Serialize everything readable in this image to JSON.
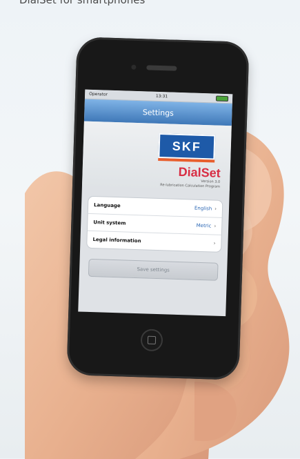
{
  "caption": "DialSet for smartphones",
  "status_bar": {
    "carrier": "Operator",
    "time": "13:31"
  },
  "navbar": {
    "title": "Settings"
  },
  "branding": {
    "logo_text": "SKF",
    "app_name": "DialSet",
    "version": "Version 3.0",
    "tagline": "Re-lubrication Calculation Program"
  },
  "settings_list": [
    {
      "label": "Language",
      "value": "English",
      "chevron": "›"
    },
    {
      "label": "Unit system",
      "value": "Metric",
      "chevron": "›"
    },
    {
      "label": "Legal information",
      "value": "",
      "chevron": "›"
    }
  ],
  "save_button": {
    "label": "Save settings"
  },
  "colors": {
    "skf_blue": "#1e5aa8",
    "dialset_red": "#d82e44",
    "navbar_blue": "#3f78b8"
  },
  "icons": [
    "signal-icon",
    "wifi-icon",
    "battery-icon",
    "chevron-right-icon",
    "home-button-icon"
  ]
}
